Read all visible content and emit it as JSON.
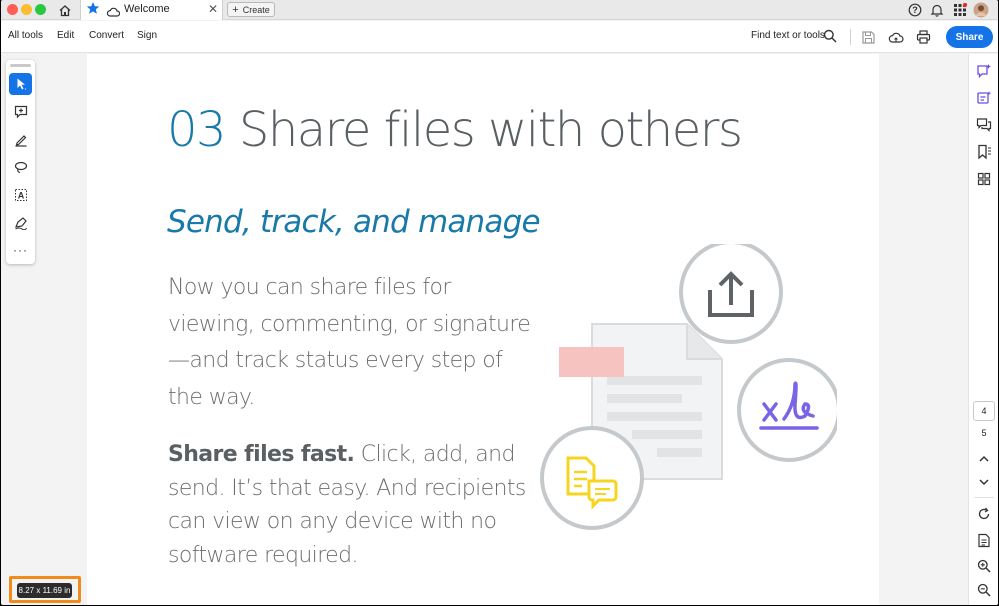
{
  "titlebar": {
    "tab_label": "Welcome",
    "create_label": "Create"
  },
  "menu": {
    "items": [
      "All tools",
      "Edit",
      "Convert",
      "Sign"
    ],
    "find_label": "Find text or tools",
    "share_label": "Share"
  },
  "document": {
    "heading_number": "03",
    "heading_text": "Share files with others",
    "subheading": "Send, track, and manage",
    "paragraph1": "Now you can share files for viewing, commenting, or signature—and track status every step of the way.",
    "paragraph2_bold": "Share files fast.",
    "paragraph2_rest": " Click, add, and send. It’s that easy. And recipients can view on any device with no software required."
  },
  "page_nav": {
    "current": "4",
    "total": "5"
  },
  "page_size": "8.27 x 11.69 in",
  "colors": {
    "accent_blue": "#1473e6",
    "heading_blue": "#1979a8",
    "signature_purple": "#7b63e6",
    "highlight_orange": "#f08c1c"
  },
  "icons": [
    "home-icon",
    "star-icon",
    "cloud-icon",
    "help-icon",
    "bell-icon",
    "apps-icon",
    "avatar",
    "search-icon",
    "save-icon",
    "cloud-sync-icon",
    "print-icon",
    "select-arrow-icon",
    "add-comment-icon",
    "highlight-pen-icon",
    "lasso-icon",
    "text-select-icon",
    "sign-pen-icon",
    "more-icon",
    "ai-assistant-icon",
    "ai-summary-icon",
    "comments-icon",
    "bookmark-icon",
    "thumbnails-icon",
    "chevron-up-icon",
    "chevron-down-icon",
    "rotate-icon",
    "page-extract-icon",
    "zoom-in-icon",
    "zoom-out-icon"
  ]
}
